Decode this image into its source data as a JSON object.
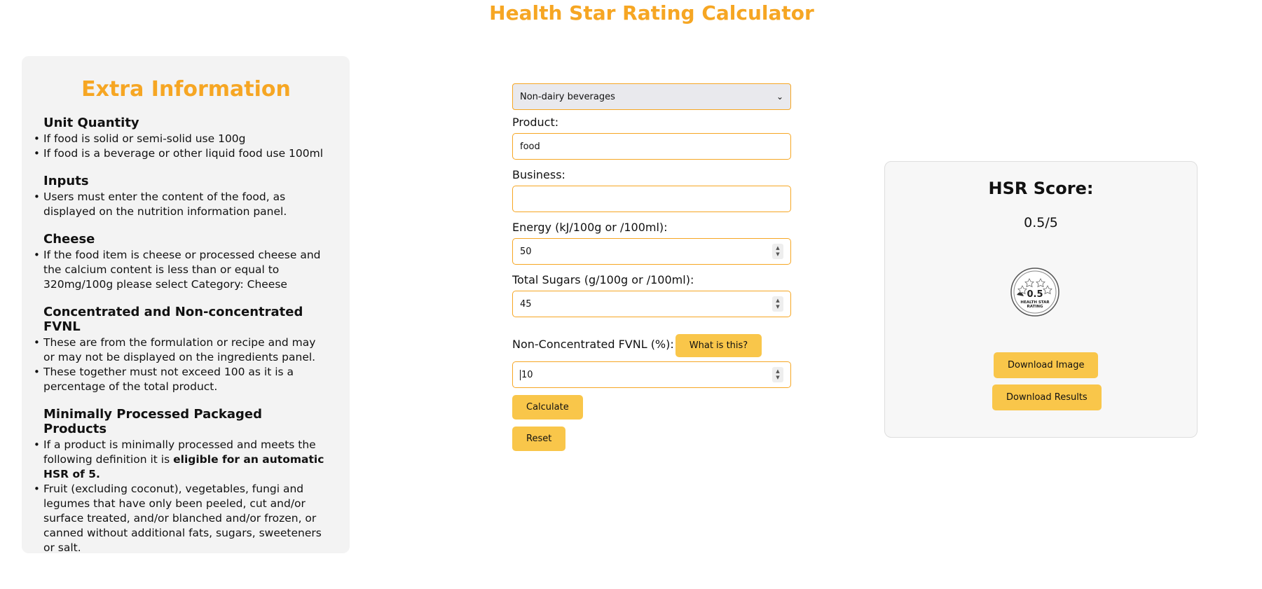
{
  "page": {
    "title": "Health Star Rating Calculator"
  },
  "info": {
    "heading": "Extra Information",
    "sections": [
      {
        "title": "Unit Quantity",
        "items": [
          "If food is solid or semi-solid use 100g",
          "If food is a beverage or other liquid food use 100ml"
        ]
      },
      {
        "title": "Inputs",
        "items": [
          "Users must enter the content of the food, as displayed on the nutrition information panel."
        ]
      },
      {
        "title": "Cheese",
        "items": [
          "If the food item is cheese or processed cheese and the calcium content is less than or equal to 320mg/100g please select Category: Cheese"
        ]
      },
      {
        "title": "Concentrated and Non-concentrated FVNL",
        "items": [
          "These are from the formulation or recipe and may or may not be displayed on the ingredients panel.",
          "These together must not exceed 100 as it is a percentage of the total product."
        ]
      },
      {
        "title": "Minimally Processed Packaged Products",
        "item1_text": "If a product is minimally processed and meets the following definition it is ",
        "item1_bold": "eligible for an automatic HSR of 5.",
        "item2": "Fruit (excluding coconut), vegetables, fungi and legumes that have only been peeled, cut and/or surface treated, and/or blanched and/or frozen, or canned without additional fats, sugars, sweeteners or salt."
      }
    ]
  },
  "form": {
    "category": {
      "selected": "Non-dairy beverages"
    },
    "product": {
      "label": "Product:",
      "value": "food"
    },
    "business": {
      "label": "Business:",
      "value": ""
    },
    "energy": {
      "label": "Energy (kJ/100g or /100ml):",
      "value": "50"
    },
    "sugars": {
      "label": "Total Sugars (g/100g or /100ml):",
      "value": "45"
    },
    "fvnl": {
      "label": "Non-Concentrated FVNL (%):",
      "help_label": "What is this?",
      "value": "10"
    },
    "calculate_label": "Calculate",
    "reset_label": "Reset"
  },
  "result": {
    "title": "HSR Score:",
    "score": "0.5/5",
    "badge": {
      "value": "0.5",
      "line1": "HEALTH STAR",
      "line2": "RATING"
    },
    "download_image_label": "Download Image",
    "download_results_label": "Download Results"
  },
  "colors": {
    "accent": "#f6a623",
    "button": "#f9c64a",
    "panel": "#f3f3f3"
  }
}
